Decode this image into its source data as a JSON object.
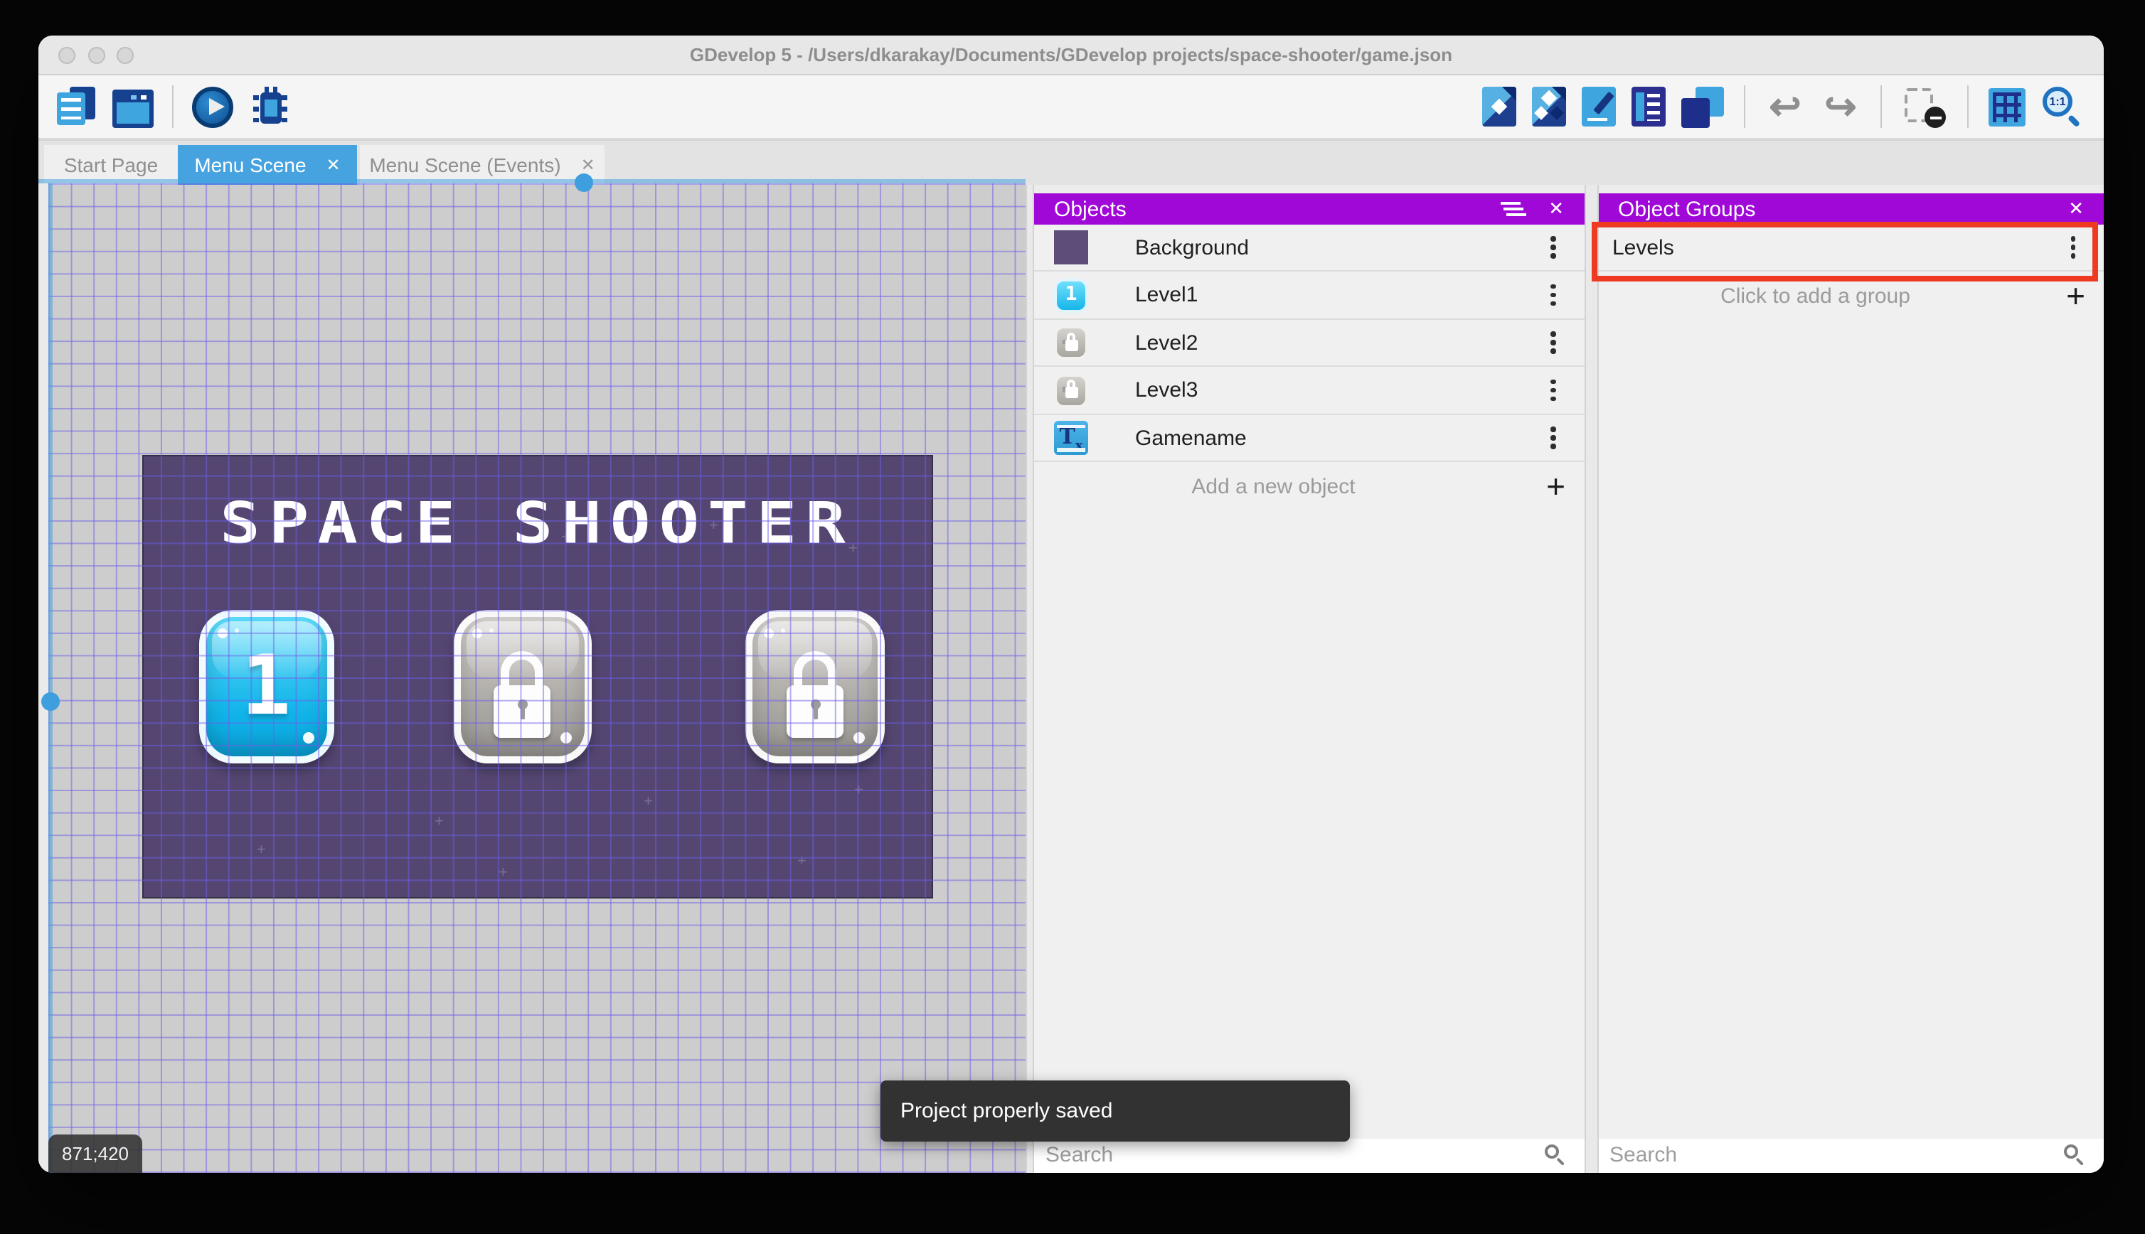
{
  "window": {
    "title": "GDevelop 5 - /Users/dkarakay/Documents/GDevelop projects/space-shooter/game.json"
  },
  "tabs": [
    {
      "label": "Start Page"
    },
    {
      "label": "Menu Scene",
      "close": "✕"
    },
    {
      "label": "Menu Scene (Events)",
      "close": "✕"
    }
  ],
  "toolbar": {
    "left_icons": [
      "project-manager",
      "scene-editor",
      "preview-play",
      "debug"
    ],
    "right_icons": [
      "open-objects-editor",
      "open-object-groups-editor",
      "open-properties",
      "open-instances-list",
      "open-layers-editor",
      "undo",
      "redo",
      "toggle-instances-mask",
      "toggle-grid",
      "zoom-original"
    ],
    "undo_glyph": "↩",
    "redo_glyph": "↪",
    "zoom_label": "1:1"
  },
  "canvas": {
    "scene_title": "SPACE SHOOTER",
    "coordinates": "871;420",
    "level_buttons": [
      {
        "label": "1",
        "locked": false
      },
      {
        "label": "",
        "locked": true
      },
      {
        "label": "",
        "locked": true
      }
    ]
  },
  "objects_panel": {
    "title": "Objects",
    "close": "✕",
    "rows": [
      {
        "name": "Background",
        "thumb": "purple-square"
      },
      {
        "name": "Level1",
        "thumb": "blue-button-1"
      },
      {
        "name": "Level2",
        "thumb": "locked-button"
      },
      {
        "name": "Level3",
        "thumb": "locked-button"
      },
      {
        "name": "Gamename",
        "thumb": "text-object"
      }
    ],
    "add_label": "Add a new object",
    "search_placeholder": "Search"
  },
  "object_groups_panel": {
    "title": "Object Groups",
    "close": "✕",
    "groups": [
      {
        "name": "Levels"
      }
    ],
    "add_label": "Click to add a group",
    "search_placeholder": "Search"
  },
  "toast": {
    "message": "Project properly saved"
  },
  "colors": {
    "header_purple": "#a008d8",
    "active_tab_blue": "#47a3e0",
    "scene_purple": "#544671",
    "grid_line": "#6c5ee8",
    "annotation_red": "#ee3a21",
    "canvas_gray": "#cdcdcd",
    "toast_bg": "#323232"
  }
}
